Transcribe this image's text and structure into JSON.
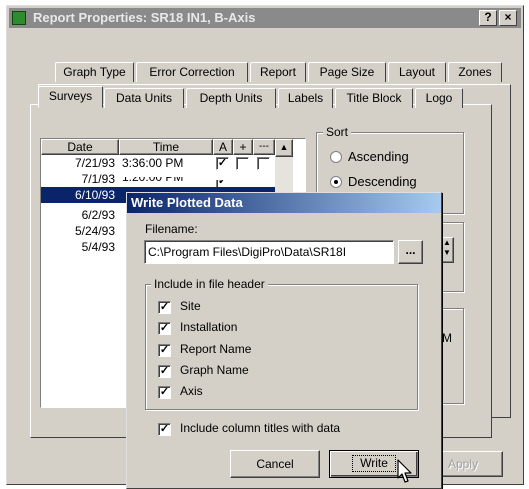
{
  "main_window": {
    "title": "Report Properties: SR18 IN1, B-Axis",
    "help_button": "?",
    "close_button": "×",
    "tabs_back_row": [
      "Graph Type",
      "Error Correction",
      "Report",
      "Page Size",
      "Layout",
      "Zones"
    ],
    "tabs_front_row": [
      "Surveys",
      "Data Units",
      "Depth Units",
      "Labels",
      "Title Block",
      "Logo"
    ],
    "surveys": {
      "columns": [
        "Date",
        "Time",
        "A",
        "+",
        "---"
      ],
      "rows": [
        {
          "date": "7/21/93",
          "time": "3:36:00 PM",
          "a": "✓"
        },
        {
          "date": "7/1/93",
          "time": "1:20:00 PM",
          "a": "✓"
        },
        {
          "date": "6/10/93",
          "time": "",
          "a": ""
        },
        {
          "date": "6/2/93",
          "time": "",
          "a": ""
        },
        {
          "date": "5/24/93",
          "time": "",
          "a": ""
        },
        {
          "date": "5/4/93",
          "time": "",
          "a": ""
        }
      ],
      "selected_index": 2
    },
    "sort": {
      "label": "Sort",
      "ascending": "Ascending",
      "descending": "Descending",
      "selected": "descending"
    },
    "partial_label_m": "M",
    "apply_button": "Apply"
  },
  "dialog": {
    "title": "Write Plotted Data",
    "filename_label": "Filename:",
    "filename_value": "C:\\Program Files\\DigiPro\\Data\\SR18I",
    "browse_button": "...",
    "header_group_label": "Include in file header",
    "header_options": [
      {
        "label": "Site",
        "checked": true
      },
      {
        "label": "Installation",
        "checked": true
      },
      {
        "label": "Report Name",
        "checked": true
      },
      {
        "label": "Graph Name",
        "checked": true
      },
      {
        "label": "Axis",
        "checked": true
      }
    ],
    "column_titles": {
      "label": "Include column titles with data",
      "checked": true
    },
    "cancel_button": "Cancel",
    "write_button": "Write"
  }
}
